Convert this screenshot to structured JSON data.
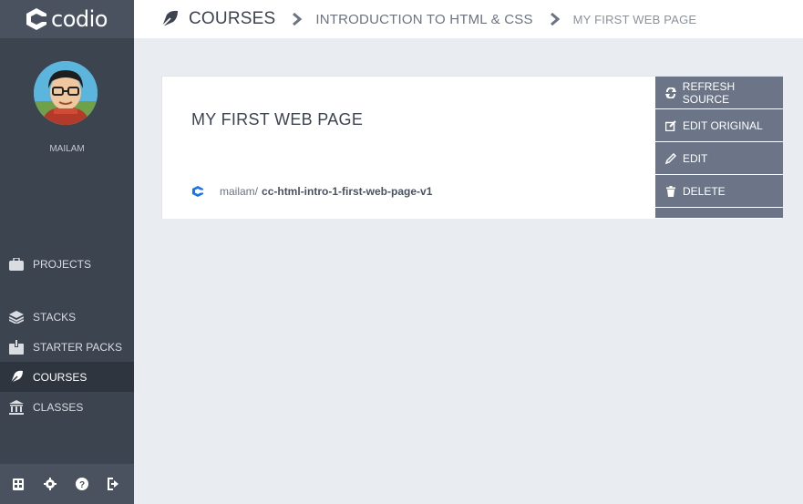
{
  "app": {
    "logo_text": "codio"
  },
  "user": {
    "name": "MAILAM"
  },
  "nav": {
    "projects": "PROJECTS",
    "stacks": "STACKS",
    "starter_packs": "STARTER PACKS",
    "courses": "COURSES",
    "classes": "CLASSES"
  },
  "breadcrumb": {
    "root": "COURSES",
    "course": "INTRODUCTION TO HTML & CSS",
    "page": "MY FIRST WEB PAGE"
  },
  "card": {
    "title": "MY FIRST WEB PAGE",
    "repo_owner": "mailam/",
    "repo_name": "cc-html-intro-1-first-web-page-v1"
  },
  "actions": {
    "refresh": "REFRESH SOURCE",
    "edit_original": "EDIT ORIGINAL",
    "edit": "EDIT",
    "delete": "DELETE"
  },
  "colors": {
    "sidebar": "#3c4450",
    "accent_blue": "#1a73e8",
    "action": "#6b7587"
  }
}
